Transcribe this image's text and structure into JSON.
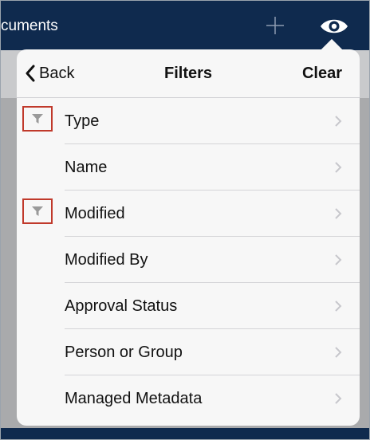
{
  "nav": {
    "title": "cuments",
    "add_icon": "plus-icon",
    "view_icon": "eye-icon",
    "color": "#0f2a4e"
  },
  "popover": {
    "back_label": "Back",
    "title": "Filters",
    "clear_label": "Clear"
  },
  "filters": [
    {
      "label": "Type",
      "active": true
    },
    {
      "label": "Name",
      "active": false
    },
    {
      "label": "Modified",
      "active": true
    },
    {
      "label": "Modified By",
      "active": false
    },
    {
      "label": "Approval Status",
      "active": false
    },
    {
      "label": "Person or Group",
      "active": false
    },
    {
      "label": "Managed Metadata",
      "active": false
    }
  ],
  "colors": {
    "highlight_box": "#c0392b",
    "funnel": "#9a9a9a",
    "chevron": "#c7c7cc"
  }
}
